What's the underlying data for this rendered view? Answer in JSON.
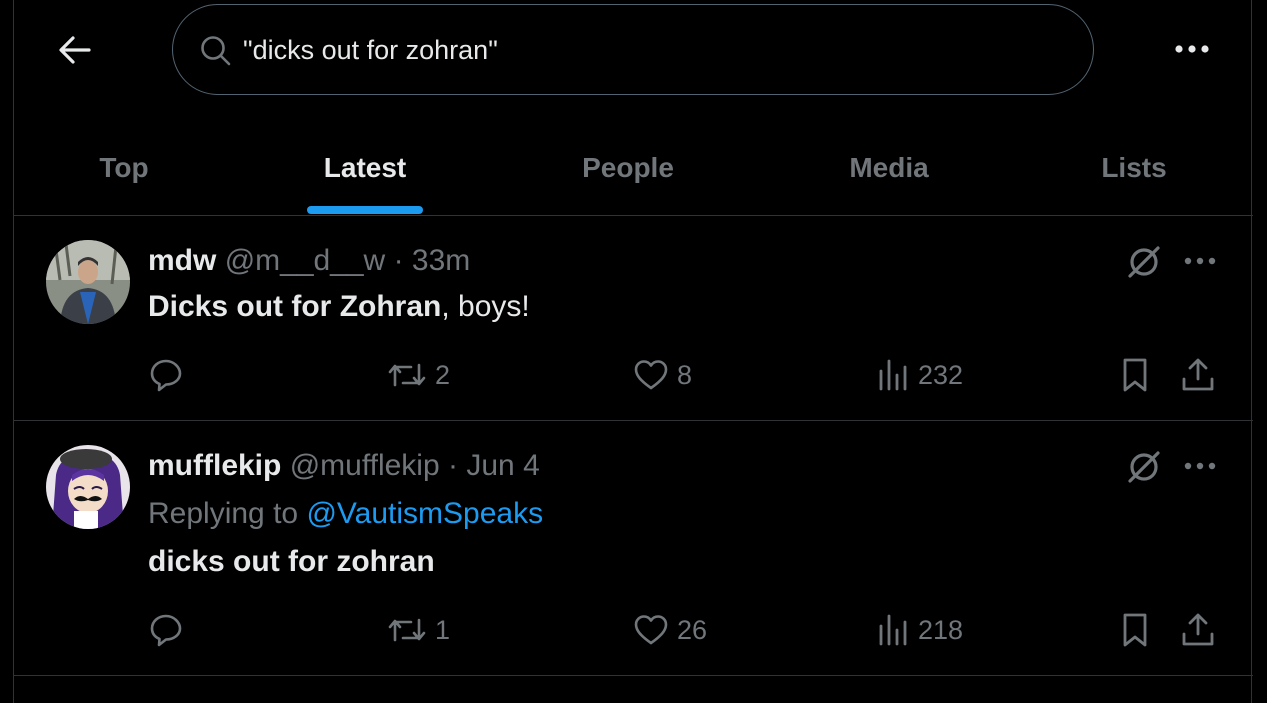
{
  "header": {
    "back_icon": "arrow-left-icon",
    "search_value": "\"dicks out for zohran\"",
    "search_icon": "search-icon",
    "more_icon": "more-horizontal-icon"
  },
  "tabs": [
    {
      "label": "Top",
      "active": false
    },
    {
      "label": "Latest",
      "active": true
    },
    {
      "label": "People",
      "active": false
    },
    {
      "label": "Media",
      "active": false
    },
    {
      "label": "Lists",
      "active": false
    }
  ],
  "colors": {
    "background": "#000000",
    "accent": "#1d9bf0",
    "text": "#e7e9ea",
    "muted": "#71767b",
    "border": "#2f3336"
  },
  "tweets": [
    {
      "name": "mdw",
      "handle": "@m__d__w",
      "dot": "·",
      "time": "33m",
      "body_bold": "Dicks out for Zohran",
      "body_rest": ", boys!",
      "replies": "",
      "reposts": "2",
      "likes": "8",
      "views": "232"
    },
    {
      "name": "mufflekip",
      "handle": "@mufflekip",
      "dot": "·",
      "time": "Jun 4",
      "replying_label": "Replying to ",
      "replying_to": "@VautismSpeaks",
      "body_bold": "dicks out for zohran",
      "replies": "",
      "reposts": "1",
      "likes": "26",
      "views": "218"
    }
  ]
}
